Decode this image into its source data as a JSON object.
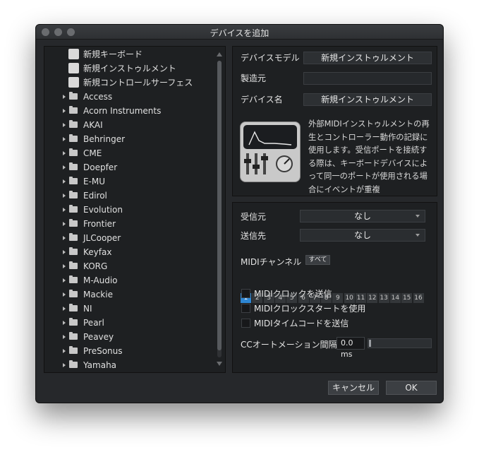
{
  "window": {
    "title": "デバイスを追加"
  },
  "tree": {
    "items": [
      {
        "label": "新規キーボード",
        "type": "template",
        "icon": "keyboard-icon"
      },
      {
        "label": "新規インストゥルメント",
        "type": "template",
        "icon": "instrument-icon"
      },
      {
        "label": "新規コントロールサーフェス",
        "type": "template",
        "icon": "control-surface-icon"
      },
      {
        "label": "Access",
        "type": "folder"
      },
      {
        "label": "Acorn Instruments",
        "type": "folder"
      },
      {
        "label": "AKAI",
        "type": "folder"
      },
      {
        "label": "Behringer",
        "type": "folder"
      },
      {
        "label": "CME",
        "type": "folder"
      },
      {
        "label": "Doepfer",
        "type": "folder"
      },
      {
        "label": "E-MU",
        "type": "folder"
      },
      {
        "label": "Edirol",
        "type": "folder"
      },
      {
        "label": "Evolution",
        "type": "folder"
      },
      {
        "label": "Frontier",
        "type": "folder"
      },
      {
        "label": "JLCooper",
        "type": "folder"
      },
      {
        "label": "Keyfax",
        "type": "folder"
      },
      {
        "label": "KORG",
        "type": "folder"
      },
      {
        "label": "M-Audio",
        "type": "folder"
      },
      {
        "label": "Mackie",
        "type": "folder"
      },
      {
        "label": "NI",
        "type": "folder"
      },
      {
        "label": "Pearl",
        "type": "folder"
      },
      {
        "label": "Peavey",
        "type": "folder"
      },
      {
        "label": "PreSonus",
        "type": "folder"
      },
      {
        "label": "Yamaha",
        "type": "folder"
      }
    ]
  },
  "device": {
    "model_label": "デバイスモデル",
    "model_value": "新規インストゥルメント",
    "maker_label": "製造元",
    "maker_value": "",
    "name_label": "デバイス名",
    "name_value": "新規インストゥルメント",
    "description": "外部MIDIインストゥルメントの再生とコントローラー動作の記録に使用します。受信ポートを接続する際は、キーボードデバイスによって同一のポートが使用される場合にイベントが重複"
  },
  "ports": {
    "receive_label": "受信元",
    "receive_value": "なし",
    "send_label": "送信先",
    "send_value": "なし"
  },
  "midi": {
    "channel_label": "MIDIチャンネル",
    "all_label": "すべて",
    "channels": [
      "1",
      "2",
      "3",
      "4",
      "5",
      "6",
      "7",
      "8",
      "9",
      "10",
      "11",
      "12",
      "13",
      "14",
      "15",
      "16"
    ],
    "selected_channel": "1"
  },
  "options": [
    {
      "label": "MIDIクロックを送信",
      "checked": false
    },
    {
      "label": "MIDIクロックスタートを使用",
      "checked": false
    },
    {
      "label": "MIDIタイムコードを送信",
      "checked": false
    }
  ],
  "cc": {
    "label": "CCオートメーション間隔",
    "value": "0.0 ms",
    "slider_level": 0.0
  },
  "buttons": {
    "cancel": "キャンセル",
    "ok": "OK"
  },
  "colors": {
    "accent": "#2e86d3",
    "panel": "#1e2022",
    "window": "#26282b"
  }
}
